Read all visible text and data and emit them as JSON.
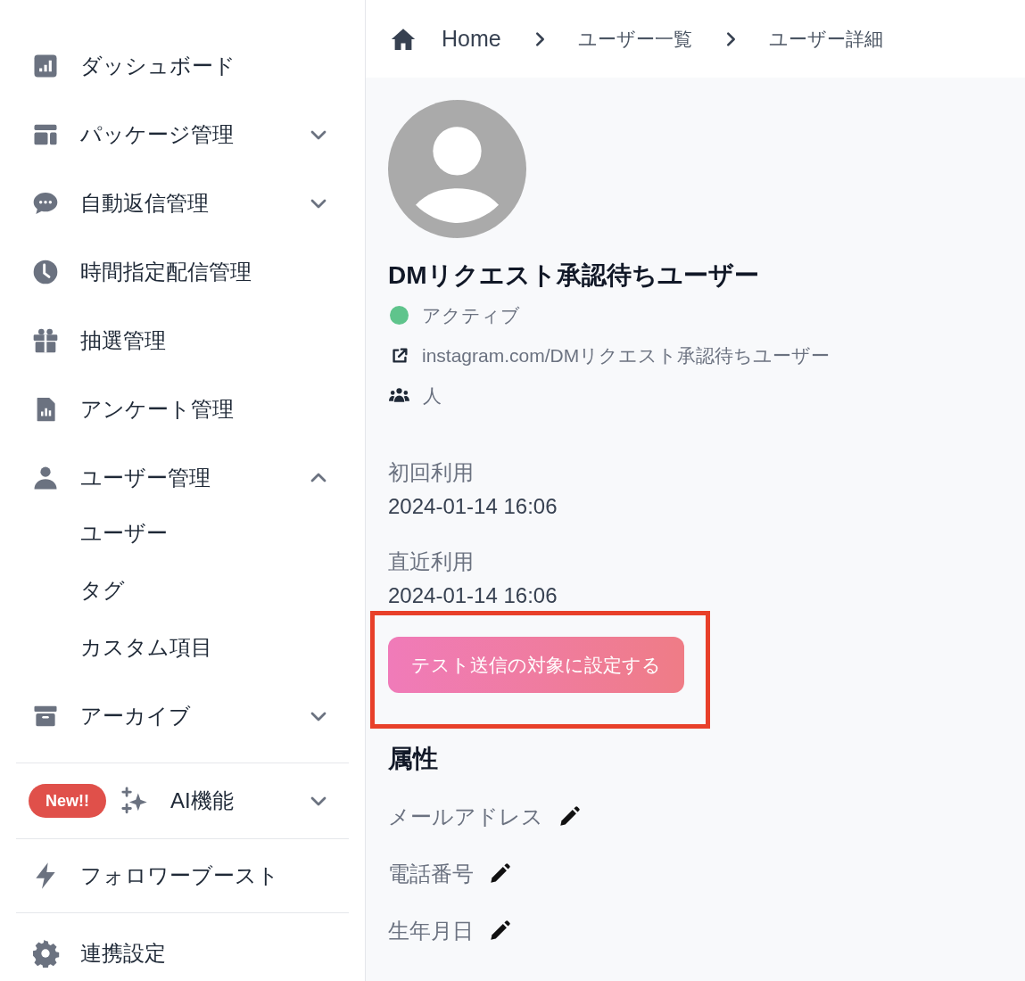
{
  "sidebar": {
    "items": [
      {
        "kind": "nav",
        "label": "ダッシュボード"
      },
      {
        "kind": "nav",
        "label": "パッケージ管理",
        "expanded": false
      },
      {
        "kind": "nav",
        "label": "自動返信管理",
        "expanded": false
      },
      {
        "kind": "nav",
        "label": "時間指定配信管理"
      },
      {
        "kind": "nav",
        "label": "抽選管理"
      },
      {
        "kind": "nav",
        "label": "アンケート管理"
      },
      {
        "kind": "nav",
        "label": "ユーザー管理",
        "expanded": true,
        "children": [
          {
            "label": "ユーザー"
          },
          {
            "label": "タグ"
          },
          {
            "label": "カスタム項目"
          }
        ]
      },
      {
        "kind": "nav",
        "label": "アーカイブ",
        "expanded": false
      },
      {
        "kind": "divider"
      },
      {
        "kind": "nav",
        "label": "AI機能",
        "badge": "New!!",
        "expanded": false
      },
      {
        "kind": "divider"
      },
      {
        "kind": "nav",
        "label": "フォロワーブースト"
      },
      {
        "kind": "divider"
      },
      {
        "kind": "nav",
        "label": "連携設定"
      }
    ]
  },
  "breadcrumb": [
    "Home",
    "ユーザー一覧",
    "ユーザー詳細"
  ],
  "profile": {
    "name": "DMリクエスト承認待ちユーザー",
    "status": {
      "label": "アクティブ",
      "color": "#5fc48c"
    },
    "link": "instagram.com/DMリクエスト承認待ちユーザー",
    "members": "人"
  },
  "usage": [
    {
      "label": "初回利用",
      "value": "2024-01-14 16:06"
    },
    {
      "label": "直近利用",
      "value": "2024-01-14 16:06"
    }
  ],
  "action": {
    "label": "テスト送信の対象に設定する",
    "highlighted": true
  },
  "attributes": {
    "title": "属性",
    "fields": [
      {
        "label": "メールアドレス"
      },
      {
        "label": "電話番号"
      },
      {
        "label": "生年月日"
      }
    ]
  }
}
